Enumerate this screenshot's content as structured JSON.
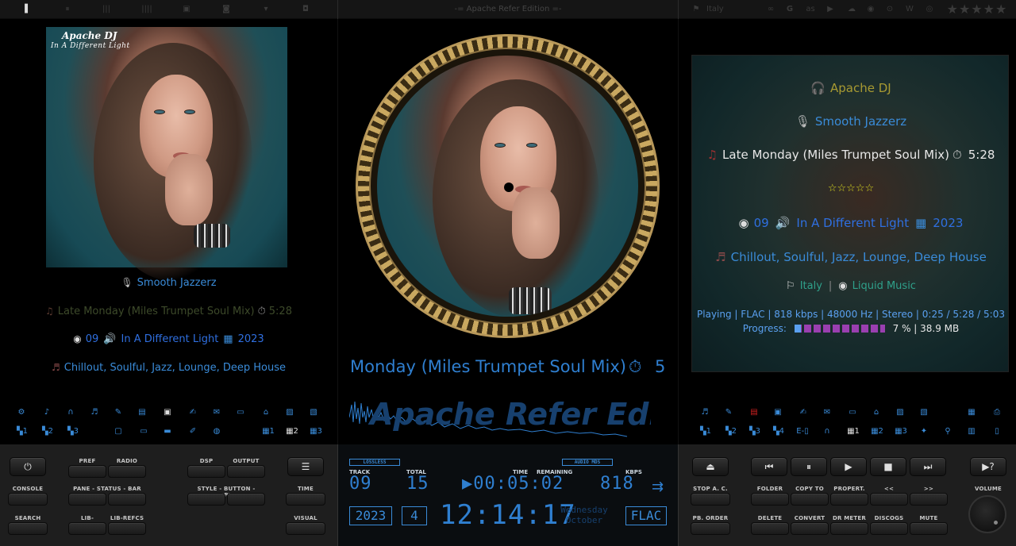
{
  "window": {
    "title": "-= Apache Refer Edition =-"
  },
  "topbar": {
    "country": "Italy",
    "icons": [
      "layout-1-icon",
      "layout-2-icon",
      "layout-3-icon",
      "layout-4-icon",
      "nav-up-icon",
      "nav-center-icon",
      "nav-down-icon",
      "nav-square-icon"
    ],
    "right_icons": [
      "link-icon",
      "google-icon",
      "lastfm-icon",
      "youtube-icon",
      "soundcloud-icon",
      "spotify-icon",
      "discogs-icon",
      "wikipedia-icon",
      "podcast-icon"
    ],
    "rating_stars": 5
  },
  "album_art": {
    "artist_overlay": "Apache DJ",
    "album_overlay": "In A Different Light"
  },
  "left": {
    "artist": "Smooth Jazzerz",
    "title_line": "Late Monday (Miles Trumpet Soul Mix)",
    "duration": "5:28",
    "track_no": "09",
    "album": "In A Different Light",
    "year": "2023",
    "genres": "Chillout, Soulful, Jazz, Lounge, Deep House"
  },
  "center": {
    "scroll_text": "Monday (Miles Trumpet Soul Mix)",
    "scroll_time": "5",
    "watermark": "Apache Refer Edition"
  },
  "right": {
    "album_artist": "Apache DJ",
    "artist": "Smooth Jazzerz",
    "title": "Late Monday (Miles Trumpet Soul Mix)",
    "duration": "5:28",
    "rating": "☆☆☆☆☆",
    "track_no": "09",
    "album": "In A Different Light",
    "year": "2023",
    "genres": "Chillout, Soulful, Jazz, Lounge, Deep House",
    "country": "Italy",
    "label": "Liquid Music",
    "status": "Playing | FLAC | 818 kbps | 48000 Hz | Stereo | 0:25 / 5:28 / 5:03",
    "progress_label": "Progress:",
    "progress_text": "7 % | 38.9 MB",
    "progress_pct": 7
  },
  "left_buttons": {
    "pref": "PREF",
    "radio": "RADIO",
    "dsp": "DSP",
    "output": "OUTPUT",
    "console": "CONSOLE",
    "pane_status_bar": "PANE - STATUS - BAR",
    "style_button_depth": "STYLE - BUTTON - DEPTH",
    "time": "TIME",
    "search": "SEARCH",
    "lib_search": "LIB-SEARCH",
    "lib_refcs": "LIB-REFCS",
    "visual": "VISUAL"
  },
  "lcd": {
    "lossless": "LOSSLESS",
    "audio_mds": "AUDIO MDS",
    "track_label": "TRACK",
    "total_label": "TOTAL",
    "time_label": "TIME",
    "remaining_label": "REMAINING",
    "kbps_label": "KBPS",
    "track": "09",
    "total": "15",
    "time": "▶00:05:02",
    "kbps": "818",
    "year": "2023",
    "day": "4",
    "clock": "12:14:17",
    "weekday": "Wednesday",
    "month": "October",
    "codec": "FLAC"
  },
  "right_buttons": {
    "stop_ac": "STOP A. C.",
    "folder": "FOLDER",
    "copy_to": "COPY TO",
    "propert": "PROPERT.",
    "prev": "<<",
    "next": ">>",
    "volume": "VOLUME",
    "pb_order": "PB. ORDER",
    "delete": "DELETE",
    "convert": "CONVERT",
    "dr_meter": "DR METER",
    "discogs": "DISCOGS",
    "mute": "MUTE"
  }
}
